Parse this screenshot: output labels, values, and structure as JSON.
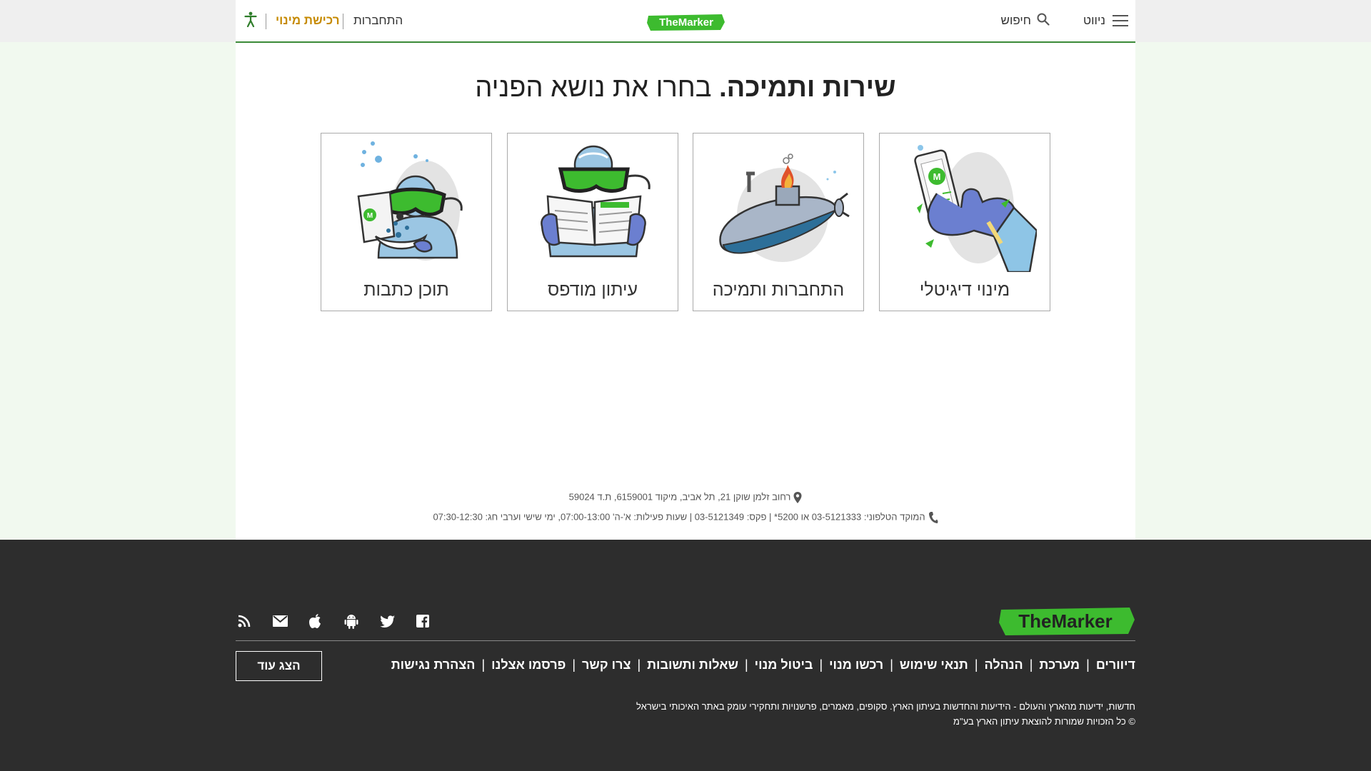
{
  "header": {
    "menu_label": "ניווט",
    "search_label": "חיפוש",
    "logo_text": "TheMarker",
    "login_label": "התחברות",
    "subscribe_label": "רכישת מינוי"
  },
  "main": {
    "title_bold": "שירות ותמיכה.",
    "title_rest": " בחרו את נושא הפניה",
    "cards": [
      {
        "label": "מינוי דיגיטלי"
      },
      {
        "label": "התחברות ותמיכה"
      },
      {
        "label": "עיתון מודפס"
      },
      {
        "label": "תוכן כתבות"
      }
    ],
    "address": "רחוב זלמן שוקן 21, תל אביב, מיקוד 6159001, ת.ד 59024",
    "phone_line": "המוקד הטלפוני: 03-5121333 או 5200* | פקס: 03-5121349 | שעות פעילות: א'-ה' 07:00-13:00, ימי שישי וערבי חג: 07:30-12:30"
  },
  "footer": {
    "logo_text": "TheMarker",
    "links": [
      "דיוורים",
      "מערכת",
      "הנהלה",
      "תנאי שימוש",
      "רכשו מנוי",
      "ביטול מנוי",
      "שאלות ותשובות",
      "צרו קשר",
      "פרסמו אצלנו",
      "הצהרת נגישות"
    ],
    "more_label": "הצג עוד",
    "tagline": "חדשות, ידיעות מהארץ והעולם - הידיעות והחדשות בעיתון הארץ. סקופים, מאמרים, פרשנויות ותחקירי עומק באתר האיכותי בישראל",
    "copyright": "© כל הזכויות שמורות להוצאת עיתון הארץ בע\"מ"
  },
  "colors": {
    "brand_green": "#3dbb2f",
    "subscribe_gold": "#c68a00",
    "footer_bg": "#2d2d2d",
    "page_bg": "#f1f9ef"
  },
  "icons": [
    "hamburger-icon",
    "search-icon",
    "accessibility-icon",
    "location-pin-icon",
    "phone-icon",
    "rss-icon",
    "mail-icon",
    "apple-icon",
    "android-icon",
    "twitter-icon",
    "facebook-icon"
  ]
}
